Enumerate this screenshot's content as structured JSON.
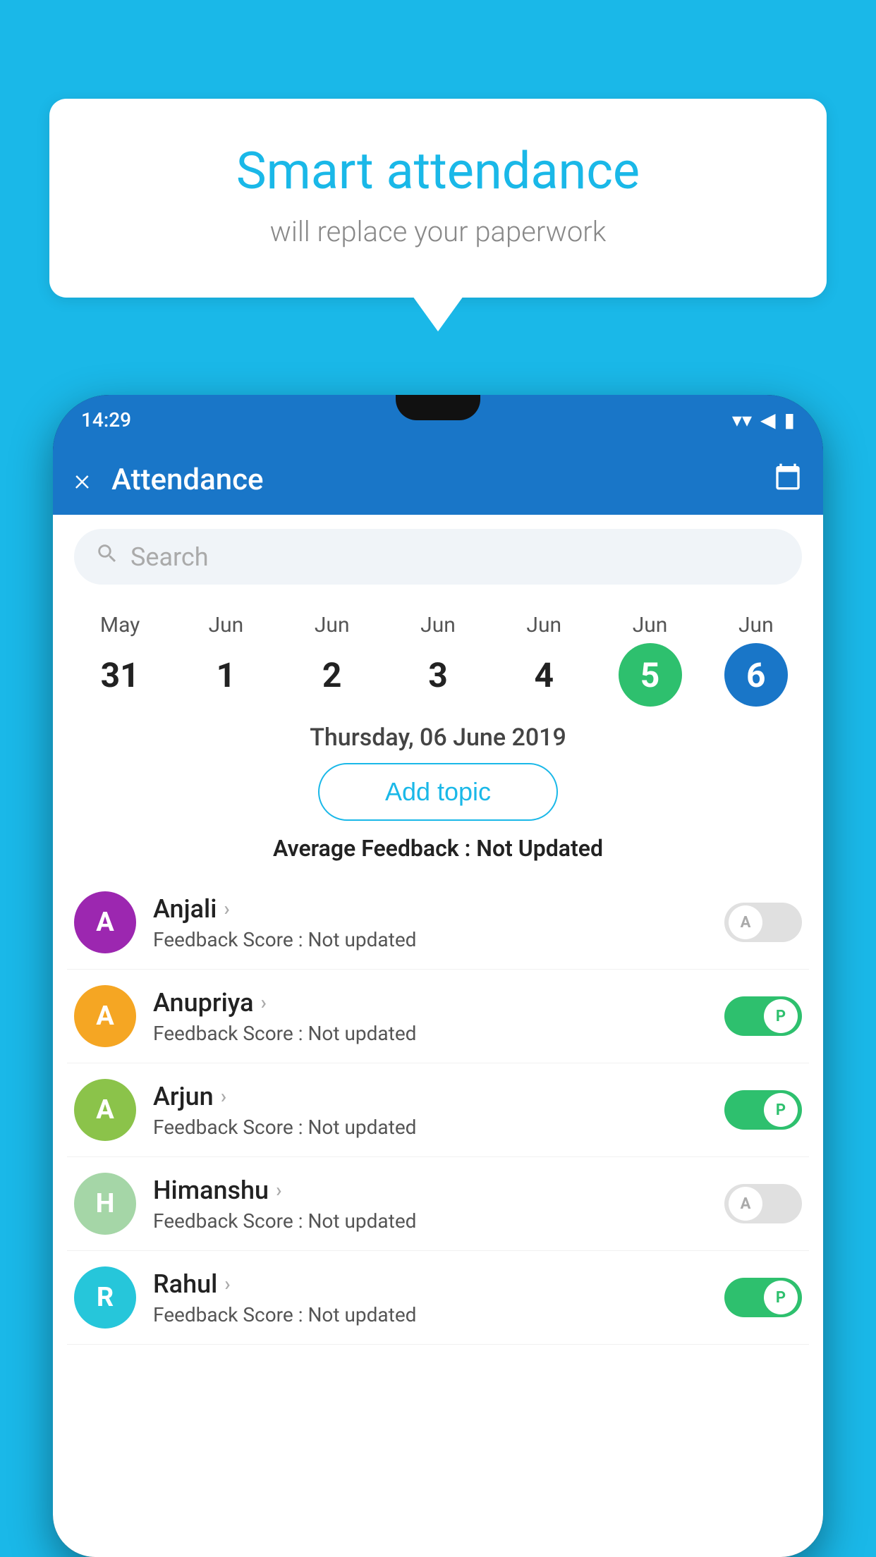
{
  "background_color": "#1ab8e8",
  "bubble": {
    "title": "Smart attendance",
    "subtitle": "will replace your paperwork"
  },
  "status_bar": {
    "time": "14:29",
    "wifi": "▼",
    "signal": "◀",
    "battery": "▮"
  },
  "app_bar": {
    "title": "Attendance",
    "close_label": "×",
    "calendar_label": "📅"
  },
  "search": {
    "placeholder": "Search"
  },
  "calendar": {
    "days": [
      {
        "month": "May",
        "num": "31",
        "highlight": "none"
      },
      {
        "month": "Jun",
        "num": "1",
        "highlight": "none"
      },
      {
        "month": "Jun",
        "num": "2",
        "highlight": "none"
      },
      {
        "month": "Jun",
        "num": "3",
        "highlight": "none"
      },
      {
        "month": "Jun",
        "num": "4",
        "highlight": "none"
      },
      {
        "month": "Jun",
        "num": "5",
        "highlight": "green"
      },
      {
        "month": "Jun",
        "num": "6",
        "highlight": "blue"
      }
    ]
  },
  "selected_date": "Thursday, 06 June 2019",
  "add_topic_label": "Add topic",
  "avg_feedback_label": "Average Feedback :",
  "avg_feedback_value": "Not Updated",
  "students": [
    {
      "name": "Anjali",
      "initial": "A",
      "avatar_color": "#9c27b0",
      "feedback_label": "Feedback Score :",
      "feedback_value": "Not updated",
      "toggle_state": "off",
      "toggle_letter": "A"
    },
    {
      "name": "Anupriya",
      "initial": "A",
      "avatar_color": "#f5a623",
      "feedback_label": "Feedback Score :",
      "feedback_value": "Not updated",
      "toggle_state": "on",
      "toggle_letter": "P"
    },
    {
      "name": "Arjun",
      "initial": "A",
      "avatar_color": "#8bc34a",
      "feedback_label": "Feedback Score :",
      "feedback_value": "Not updated",
      "toggle_state": "on",
      "toggle_letter": "P"
    },
    {
      "name": "Himanshu",
      "initial": "H",
      "avatar_color": "#a5d6a7",
      "feedback_label": "Feedback Score :",
      "feedback_value": "Not updated",
      "toggle_state": "off",
      "toggle_letter": "A"
    },
    {
      "name": "Rahul",
      "initial": "R",
      "avatar_color": "#26c6da",
      "feedback_label": "Feedback Score :",
      "feedback_value": "Not updated",
      "toggle_state": "on",
      "toggle_letter": "P"
    }
  ]
}
